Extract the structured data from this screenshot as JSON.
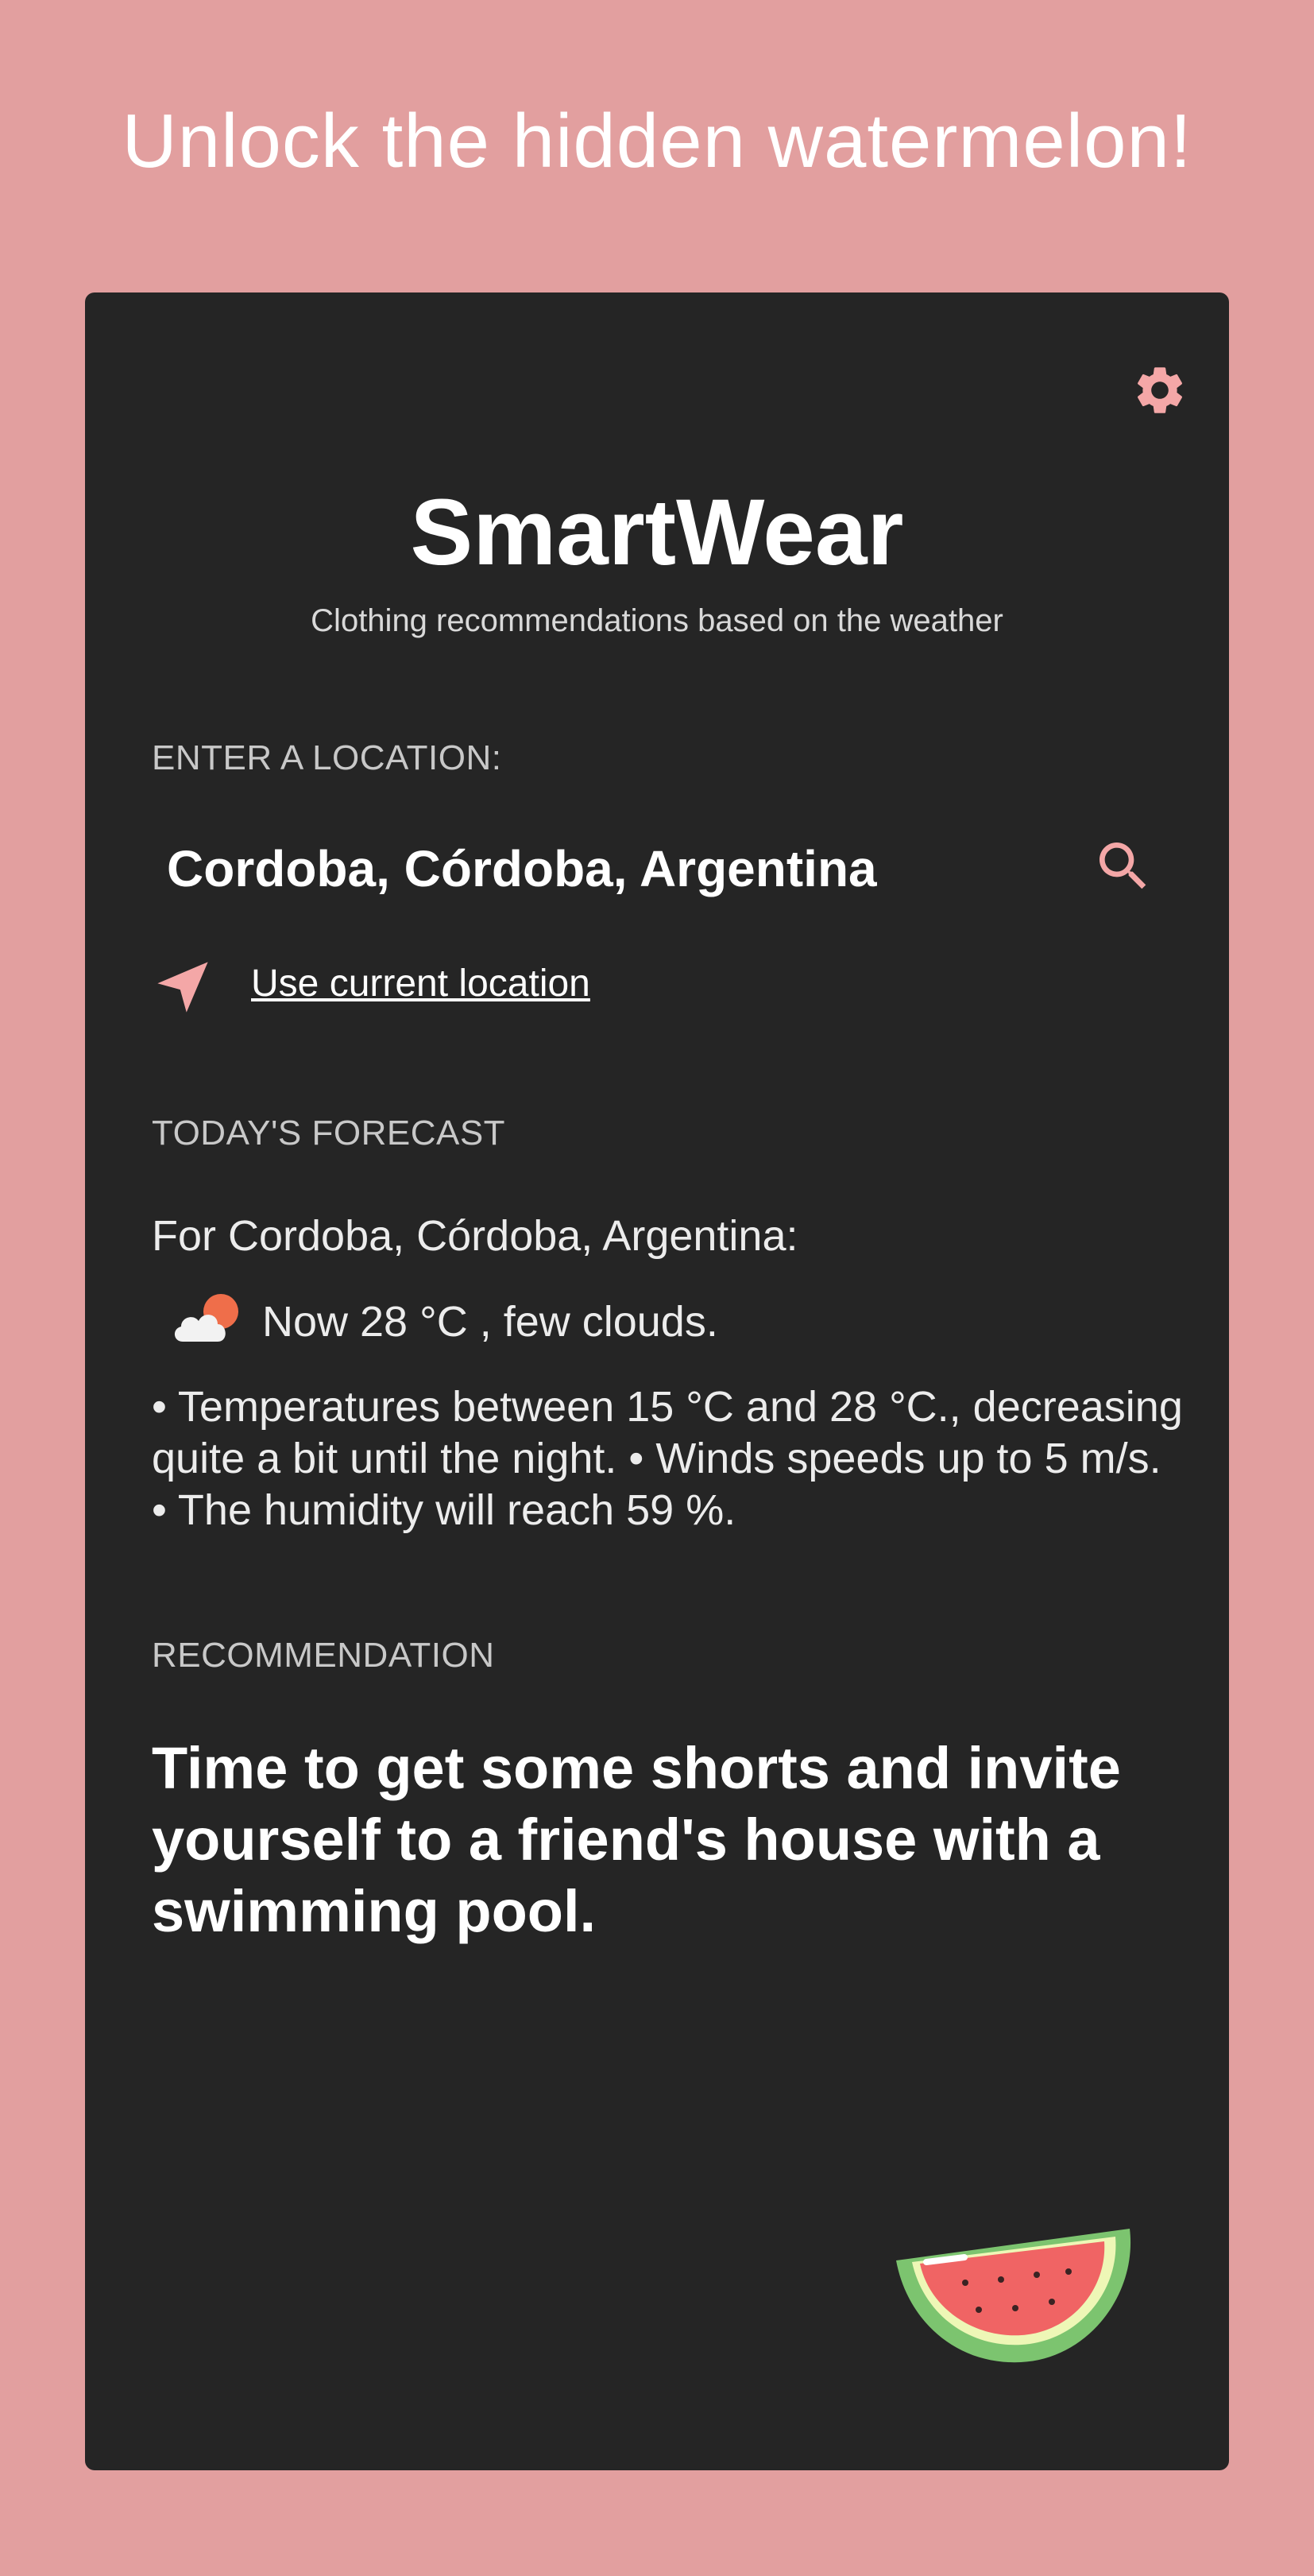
{
  "banner": {
    "text": "Unlock the hidden watermelon!"
  },
  "header": {
    "settings_icon": "gear-icon",
    "title": "SmartWear",
    "subtitle": "Clothing recommendations based on the weather"
  },
  "location": {
    "label": "ENTER A LOCATION:",
    "value": "Cordoba, Córdoba, Argentina",
    "search_icon": "search-icon",
    "use_current_label": "Use current location",
    "navigation_icon": "navigation-arrow-icon"
  },
  "forecast": {
    "label": "TODAY'S FORECAST",
    "for_text": "For Cordoba, Córdoba, Argentina:",
    "weather_icon": "partly-cloudy-icon",
    "now_text": "Now 28 °C , few clouds.",
    "details": "• Temperatures between 15 °C and 28 °C., decreasing quite a bit until the night. • Winds speeds up to 5 m/s. • The humidity will reach 59 %."
  },
  "recommendation": {
    "label": "RECOMMENDATION",
    "text": "Time to get some shorts and invite yourself to a friend's house with a swimming pool."
  },
  "easter_egg": {
    "icon": "watermelon-icon"
  },
  "colors": {
    "background": "#e29f9f",
    "card": "#252525",
    "accent": "#f4a7a7",
    "text": "#ffffff"
  }
}
